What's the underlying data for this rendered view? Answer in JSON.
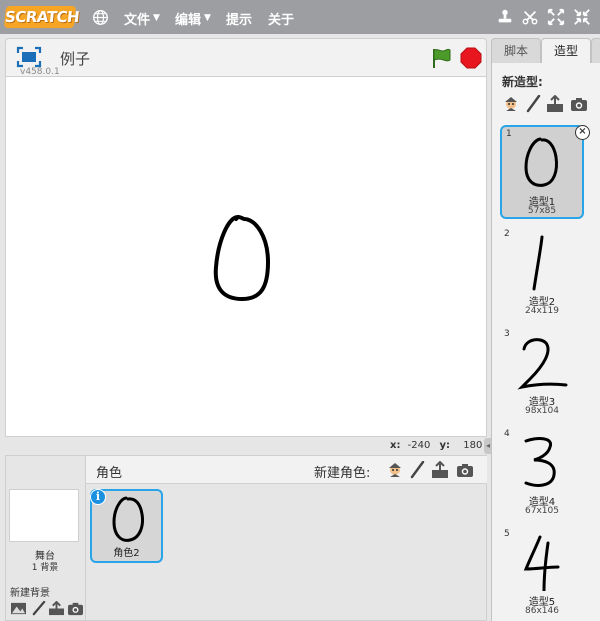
{
  "menubar": {
    "logo_text": "SCRATCH",
    "file": "文件",
    "edit": "编辑",
    "tips": "提示",
    "about": "关于"
  },
  "stage": {
    "project_title": "例子",
    "version": "v458.0.1",
    "coords": {
      "x_label": "x:",
      "x_value": "-240",
      "y_label": "y:",
      "y_value": "180"
    }
  },
  "sprites": {
    "header": "角色",
    "new_sprite": "新建角色:",
    "stage_label": "舞台",
    "backdrop_count": "1 背景",
    "new_backdrop": "新建背景",
    "items": [
      {
        "name": "角色2"
      }
    ]
  },
  "tabs": {
    "scripts": "脚本",
    "costumes": "造型"
  },
  "costumes": {
    "new_costume": "新造型:",
    "items": [
      {
        "num": "1",
        "name": "造型1",
        "size": "57x85",
        "glyph": "0"
      },
      {
        "num": "2",
        "name": "造型2",
        "size": "24x119",
        "glyph": "1"
      },
      {
        "num": "3",
        "name": "造型3",
        "size": "98x104",
        "glyph": "2"
      },
      {
        "num": "4",
        "name": "造型4",
        "size": "67x105",
        "glyph": "3"
      },
      {
        "num": "5",
        "name": "造型5",
        "size": "86x146",
        "glyph": "4"
      }
    ]
  },
  "colors": {
    "accent": "#28a4e8",
    "menubar": "#9c9ea2",
    "logo": "#f7a525",
    "flag": "#4c9a2a",
    "stop": "#e8161e"
  }
}
